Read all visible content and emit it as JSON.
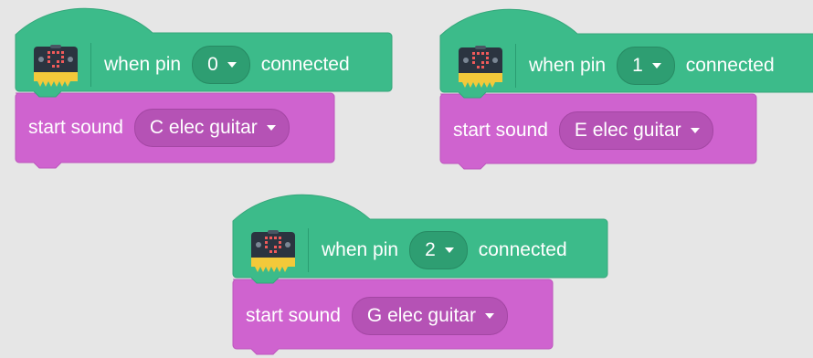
{
  "scripts": [
    {
      "hat": {
        "text_before": "when pin",
        "pin": "0",
        "text_after": "connected"
      },
      "sound": {
        "label": "start sound",
        "value": "C elec guitar"
      }
    },
    {
      "hat": {
        "text_before": "when pin",
        "pin": "1",
        "text_after": "connected"
      },
      "sound": {
        "label": "start sound",
        "value": "E elec guitar"
      }
    },
    {
      "hat": {
        "text_before": "when pin",
        "pin": "2",
        "text_after": "connected"
      },
      "sound": {
        "label": "start sound",
        "value": "G elec guitar"
      }
    }
  ],
  "icons": {
    "hat_icon": "microbit-icon",
    "dropdown_icon": "chevron-down-icon"
  },
  "colors": {
    "events_green": "#3cbb8a",
    "events_green_dark": "#2e9e72",
    "sound_purple": "#cf63cf",
    "sound_purple_dark": "#b552b5",
    "background": "#e6e6e6"
  }
}
